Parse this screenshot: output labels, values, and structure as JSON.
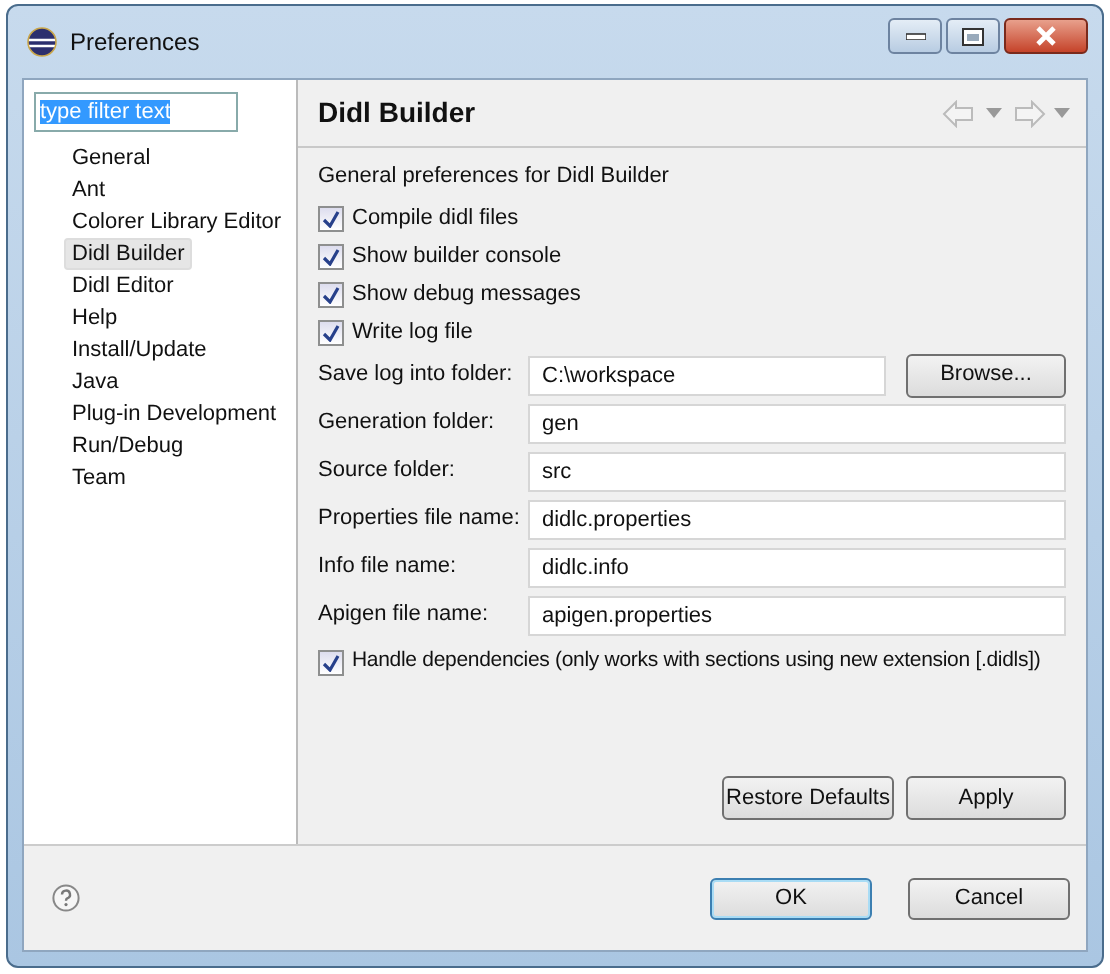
{
  "window": {
    "title": "Preferences"
  },
  "filter": {
    "value": "type filter text",
    "text_selected": true
  },
  "tree": [
    {
      "label": "General",
      "selected": false
    },
    {
      "label": "Ant",
      "selected": false
    },
    {
      "label": "Colorer Library Editor",
      "selected": false
    },
    {
      "label": "Didl Builder",
      "selected": true
    },
    {
      "label": "Didl Editor",
      "selected": false
    },
    {
      "label": "Help",
      "selected": false
    },
    {
      "label": "Install/Update",
      "selected": false
    },
    {
      "label": "Java",
      "selected": false
    },
    {
      "label": "Plug-in Development",
      "selected": false
    },
    {
      "label": "Run/Debug",
      "selected": false
    },
    {
      "label": "Team",
      "selected": false
    }
  ],
  "page": {
    "title": "Didl Builder",
    "description": "General preferences for Didl Builder",
    "checkboxes": [
      {
        "label": "Compile didl files",
        "checked": true
      },
      {
        "label": "Show builder console",
        "checked": true
      },
      {
        "label": "Show debug messages",
        "checked": true
      },
      {
        "label": "Write log file",
        "checked": true
      }
    ],
    "fields": [
      {
        "label": "Save log into folder:",
        "value": "C:\\workspace",
        "button": "Browse..."
      },
      {
        "label": "Generation folder:",
        "value": "gen"
      },
      {
        "label": "Source folder:",
        "value": "src"
      },
      {
        "label": "Properties file name:",
        "value": "didlc.properties"
      },
      {
        "label": "Info file name:",
        "value": "didlc.info"
      },
      {
        "label": "Apigen file name:",
        "value": "apigen.properties"
      }
    ],
    "dependencies": {
      "label": "Handle dependencies (only works with sections using new extension [.didls])",
      "checked": true
    },
    "buttons": [
      "Restore Defaults",
      "Apply"
    ]
  },
  "footer": {
    "buttons": [
      {
        "label": "OK",
        "default": true
      },
      {
        "label": "Cancel",
        "default": false
      }
    ]
  }
}
